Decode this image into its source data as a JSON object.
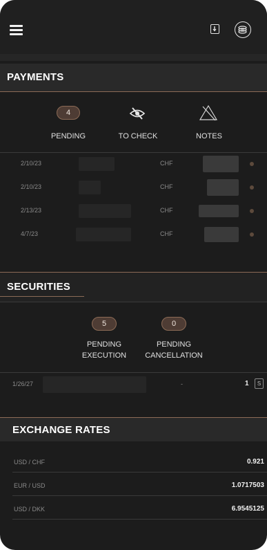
{
  "payments": {
    "title": "PAYMENTS",
    "pending_count": "4",
    "pending_label": "PENDING",
    "to_check_label": "TO CHECK",
    "notes_label": "NOTES",
    "rows": [
      {
        "date": "2/10/23",
        "currency": "CHF"
      },
      {
        "date": "2/10/23",
        "currency": "CHF"
      },
      {
        "date": "2/13/23",
        "currency": "CHF"
      },
      {
        "date": "4/7/23",
        "currency": "CHF"
      }
    ]
  },
  "securities": {
    "title": "SECURITIES",
    "pending_execution_count": "5",
    "pending_execution_line1": "PENDING",
    "pending_execution_line2": "EXECUTION",
    "pending_cancellation_count": "0",
    "pending_cancellation_line1": "PENDING",
    "pending_cancellation_line2": "CANCELLATION",
    "row": {
      "date": "1/26/27",
      "dash": "-",
      "quantity": "1",
      "tag": "S"
    }
  },
  "exchange_rates": {
    "title": "EXCHANGE RATES",
    "rows": [
      {
        "pair": "USD / CHF",
        "rate": "0.921"
      },
      {
        "pair": "EUR / USD",
        "rate": "1.0717503"
      },
      {
        "pair": "USD / DKK",
        "rate": "6.9545125"
      }
    ]
  },
  "icons": {
    "menu": "hamburger-menu-icon",
    "download": "download-icon",
    "coin": "coin-stack-icon",
    "to_check": "eye-slash-icon",
    "notes": "warning-slash-icon"
  },
  "colors": {
    "background": "#1c1c1c",
    "header_band": "#292929",
    "accent": "#8c6b56",
    "badge_fill": "#4e3c34"
  }
}
